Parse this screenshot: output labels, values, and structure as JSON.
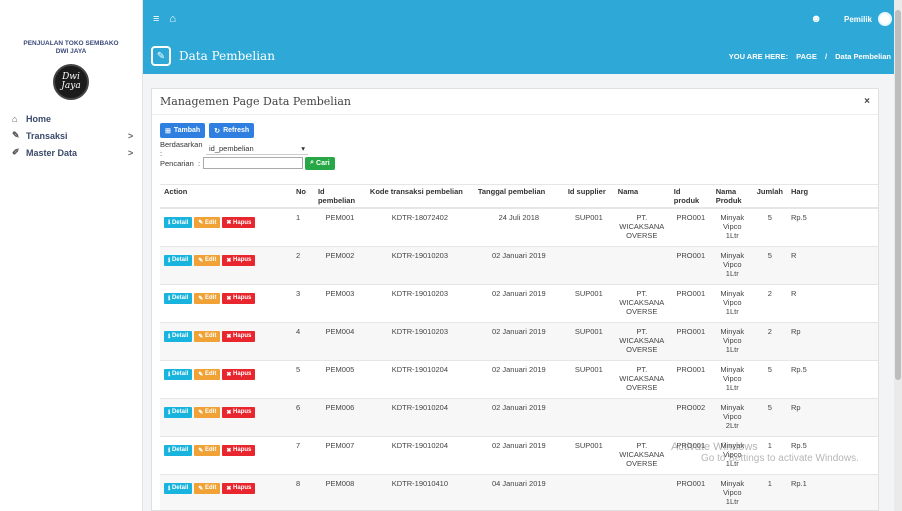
{
  "sidebar": {
    "brand_line1": "PENJUALAN TOKO SEMBAKO",
    "brand_line2": "DWI JAYA",
    "logo_line1": "Dwi",
    "logo_line2": "Jaya",
    "items": [
      {
        "label": "Home",
        "icon": "home-icon"
      },
      {
        "label": "Transaksi",
        "icon": "pencil-icon",
        "chevron": ">"
      },
      {
        "label": "Master Data",
        "icon": "edit-icon",
        "chevron": ">"
      }
    ]
  },
  "topbar": {
    "owner_label": "Pemilik"
  },
  "titlebar": {
    "page_title": "Data Pembelian",
    "crumb_prefix": "YOU ARE HERE:",
    "crumb_1": "PAGE",
    "crumb_sep": "/",
    "crumb_2": "Data Pembelian"
  },
  "panel": {
    "title": "Managemen Page Data Pembelian",
    "close": "×",
    "tambah_label": "Tambah",
    "refresh_label": "Refresh",
    "filter_label": "Berdasarkan :",
    "filter_value": "id_pembelian",
    "search_label": "Pencarian",
    "search_colon": ":",
    "search_value": "",
    "cari_label": "Cari"
  },
  "table": {
    "headers": {
      "action": "Action",
      "no": "No",
      "id_pembelian": "Id pembelian",
      "kode": "Kode transaksi pembelian",
      "tanggal": "Tanggal pembelian",
      "id_supplier": "Id supplier",
      "nama": "Nama",
      "id_produk": "Id produk",
      "nama_produk": "Nama Produk",
      "jumlah": "Jumlah",
      "harga": "Harg"
    },
    "action_labels": {
      "detail": "Detail",
      "edit": "Edit",
      "hapus": "Hapus"
    },
    "rows": [
      {
        "no": "1",
        "id": "PEM001",
        "kode": "KDTR-18072402",
        "tanggal": "24 Juli 2018",
        "supplier": "SUP001",
        "nama": "PT. WICAKSANA OVERSE",
        "produk": "PRO001",
        "nama_produk": "Minyak Vipco 1Ltr",
        "jumlah": "5",
        "harga": "Rp.5"
      },
      {
        "no": "2",
        "id": "PEM002",
        "kode": "KDTR-19010203",
        "tanggal": "02 Januari 2019",
        "supplier": "",
        "nama": "",
        "produk": "PRO001",
        "nama_produk": "Minyak Vipco 1Ltr",
        "jumlah": "5",
        "harga": "R"
      },
      {
        "no": "3",
        "id": "PEM003",
        "kode": "KDTR-19010203",
        "tanggal": "02 Januari 2019",
        "supplier": "SUP001",
        "nama": "PT. WICAKSANA OVERSE",
        "produk": "PRO001",
        "nama_produk": "Minyak Vipco 1Ltr",
        "jumlah": "2",
        "harga": "R"
      },
      {
        "no": "4",
        "id": "PEM004",
        "kode": "KDTR-19010203",
        "tanggal": "02 Januari 2019",
        "supplier": "SUP001",
        "nama": "PT. WICAKSANA OVERSE",
        "produk": "PRO001",
        "nama_produk": "Minyak Vipco 1Ltr",
        "jumlah": "2",
        "harga": "Rp"
      },
      {
        "no": "5",
        "id": "PEM005",
        "kode": "KDTR-19010204",
        "tanggal": "02 Januari 2019",
        "supplier": "SUP001",
        "nama": "PT. WICAKSANA OVERSE",
        "produk": "PRO001",
        "nama_produk": "Minyak Vipco 1Ltr",
        "jumlah": "5",
        "harga": "Rp.5"
      },
      {
        "no": "6",
        "id": "PEM006",
        "kode": "KDTR-19010204",
        "tanggal": "02 Januari 2019",
        "supplier": "",
        "nama": "",
        "produk": "PRO002",
        "nama_produk": "Minyak Vipco 2Ltr",
        "jumlah": "5",
        "harga": "Rp"
      },
      {
        "no": "7",
        "id": "PEM007",
        "kode": "KDTR-19010204",
        "tanggal": "02 Januari 2019",
        "supplier": "SUP001",
        "nama": "PT. WICAKSANA OVERSE",
        "produk": "PRO001",
        "nama_produk": "Minyak Vipco 1Ltr",
        "jumlah": "1",
        "harga": "Rp.5"
      },
      {
        "no": "8",
        "id": "PEM008",
        "kode": "KDTR-19010410",
        "tanggal": "04 Januari 2019",
        "supplier": "",
        "nama": "",
        "produk": "PRO001",
        "nama_produk": "Minyak Vipco 1Ltr",
        "jumlah": "1",
        "harga": "Rp.1"
      }
    ]
  },
  "watermark": {
    "line1": "Activate Windows",
    "line2": "Go to Settings to activate Windows."
  }
}
